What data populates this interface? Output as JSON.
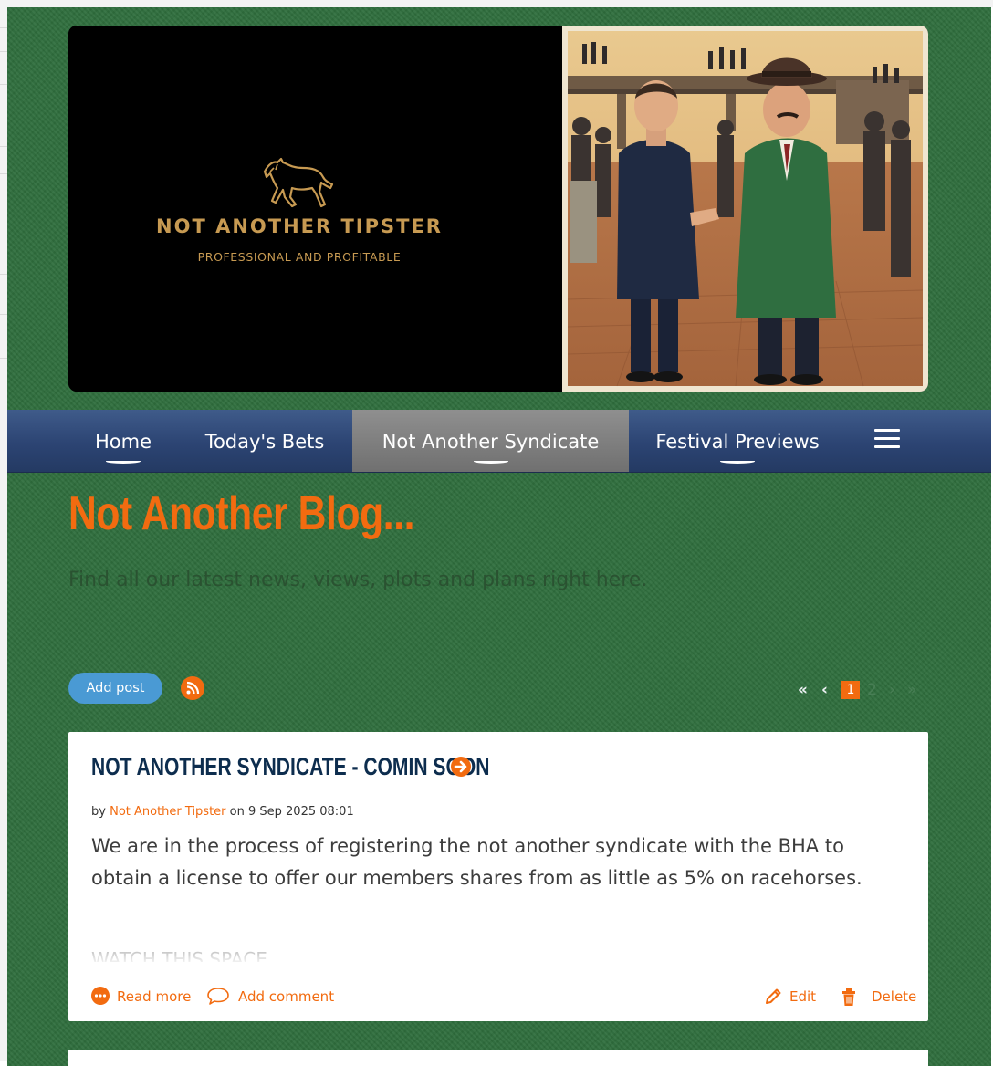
{
  "banner": {
    "brand_name": "NOT ANOTHER TIPSTER",
    "brand_tagline": "PROFESSIONAL AND PROFITABLE"
  },
  "nav": {
    "items": [
      {
        "label": "Home",
        "active": false
      },
      {
        "label": "Today's Bets",
        "active": false
      },
      {
        "label": "Not Another Syndicate",
        "active": true
      },
      {
        "label": "Festival Previews",
        "active": false
      }
    ],
    "menu_icon": "hamburger-menu-icon"
  },
  "blog": {
    "title": "Not Another Blog...",
    "subtitle": "Find all our latest news, views, plots and plans right here."
  },
  "toolbar": {
    "add_post_label": "Add post",
    "rss_icon": "rss-icon",
    "pagination": {
      "first": "«",
      "prev": "‹",
      "current_page": "1",
      "next_page": "2",
      "next": "›",
      "last": "»"
    }
  },
  "post": {
    "title": "NOT ANOTHER SYNDICATE - COMIN SOON",
    "by_label": "by",
    "author": "Not Another Tipster",
    "date_text": "on 9 Sep 2025 08:01",
    "body": "We are in the process of registering the not another syndicate with the BHA to obtain a license to offer our members shares from as little as 5% on racehorses.",
    "teaser": "WATCH THIS SPACE",
    "actions": {
      "read_more": "Read more",
      "add_comment": "Add comment",
      "edit": "Edit",
      "delete": "Delete"
    }
  },
  "colors": {
    "accent_orange": "#f26b10",
    "nav_blue": "#2c4473",
    "background_green": "#2f6e3d",
    "add_post_blue": "#4a9ad4",
    "post_title_navy": "#0d2d4e"
  }
}
